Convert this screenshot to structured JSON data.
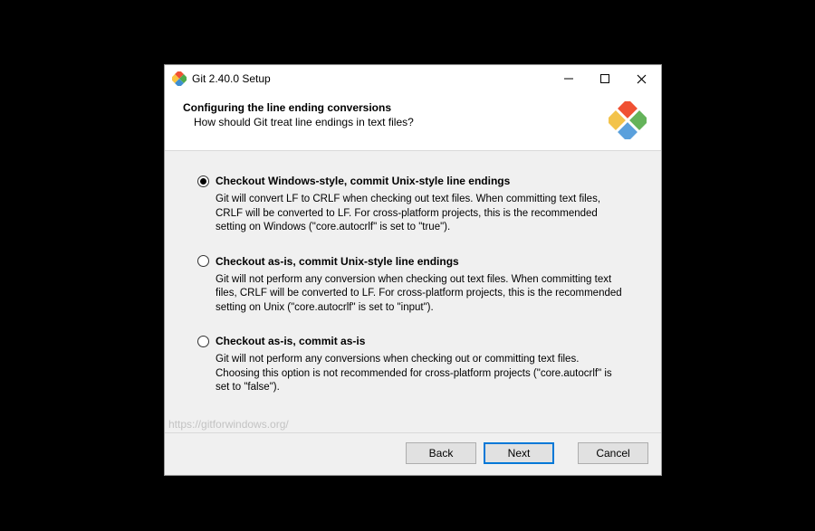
{
  "window": {
    "title": "Git 2.40.0 Setup"
  },
  "header": {
    "heading": "Configuring the line ending conversions",
    "sub": "How should Git treat line endings in text files?"
  },
  "options": [
    {
      "label": "Checkout Windows-style, commit Unix-style line endings",
      "desc": "Git will convert LF to CRLF when checking out text files. When committing text files, CRLF will be converted to LF. For cross-platform projects, this is the recommended setting on Windows (\"core.autocrlf\" is set to \"true\").",
      "selected": true
    },
    {
      "label": "Checkout as-is, commit Unix-style line endings",
      "desc": "Git will not perform any conversion when checking out text files. When committing text files, CRLF will be converted to LF. For cross-platform projects, this is the recommended setting on Unix (\"core.autocrlf\" is set to \"input\").",
      "selected": false
    },
    {
      "label": "Checkout as-is, commit as-is",
      "desc": "Git will not perform any conversions when checking out or committing text files. Choosing this option is not recommended for cross-platform projects (\"core.autocrlf\" is set to \"false\").",
      "selected": false
    }
  ],
  "watermark": "https://gitforwindows.org/",
  "buttons": {
    "back": "Back",
    "next": "Next",
    "cancel": "Cancel"
  }
}
